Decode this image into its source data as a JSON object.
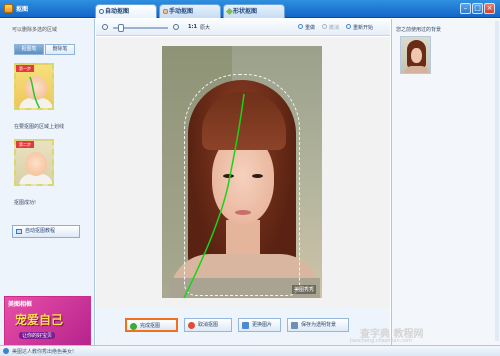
{
  "window": {
    "title": "抠图",
    "controls": [
      "–",
      "□",
      "×"
    ]
  },
  "tabs": [
    {
      "label": "自动抠图",
      "active": true,
      "icon": "scissors-icon"
    },
    {
      "label": "手动抠图",
      "active": false,
      "icon": "hand-icon"
    },
    {
      "label": "形状抠图",
      "active": false,
      "icon": "shape-icon"
    }
  ],
  "left_panel": {
    "hint": "可以删除多选的区域",
    "toggle": [
      "抠图笔",
      "删除笔"
    ],
    "toggle_active": 0,
    "example1": {
      "tag": "第一步",
      "caption": "在要抠图的区域上划线"
    },
    "example2": {
      "tag": "第二步",
      "caption": "抠图成功!"
    },
    "tutorial_label": "自动抠图教程"
  },
  "ad": {
    "brand": "美图相框",
    "title": "宠爱自己",
    "subtitle": "让你的好宝贝"
  },
  "toolbar": {
    "zoom_level": "1:1",
    "fit_label": "原大",
    "redo_label": "重做",
    "undo_label": "撤消",
    "reset_label": "重新开始"
  },
  "canvas": {
    "watermark": "美图秀秀"
  },
  "actions": {
    "done": "完成抠图",
    "cancel": "取消抠图",
    "replace": "更换图片",
    "save_transparent": "保存为透明背景"
  },
  "right_panel": {
    "title": "您之前使用过的背景"
  },
  "status": {
    "text": "美图达人教你秀出绝色美女!"
  },
  "site_watermark": {
    "main": "查字典 教程网",
    "sub": "jiaocheng.chazidian.com"
  },
  "colors": {
    "titlebar": "#1f7bd6",
    "primary_outline": "#f26f1e",
    "stroke": "#18d418"
  }
}
